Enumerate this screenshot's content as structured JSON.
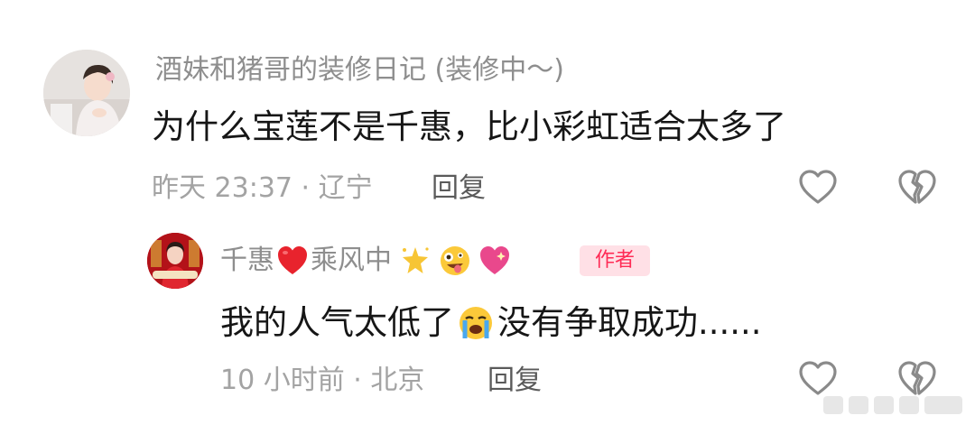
{
  "comment": {
    "username": "酒妹和猪哥的装修日记 (装修中～)",
    "text": "为什么宝莲不是千惠，比小彩虹适合太多了",
    "meta": "昨天 23:37 · 辽宁",
    "reply_label": "回复",
    "like_icon": "heart-outline-icon",
    "dislike_icon": "broken-heart-icon"
  },
  "reply": {
    "username_part1": "千惠",
    "username_part2": "乘风中",
    "badge": "作者",
    "text_part1": "我的人气太低了",
    "text_part2": "没有争取成功......",
    "meta": "10 小时前 · 北京",
    "reply_label": "回复",
    "like_icon": "heart-outline-icon",
    "dislike_icon": "broken-heart-icon",
    "username_emojis": [
      "red-heart-emoji",
      "sparkle-star-emoji",
      "zany-face-emoji",
      "sparkling-heart-emoji"
    ],
    "text_emoji": "loudly-crying-face-emoji"
  },
  "colors": {
    "username": "#8e8e8e",
    "text": "#161616",
    "meta": "#a3a3a3",
    "badge_bg": "#ffe0e6",
    "badge_text": "#ff2b55"
  }
}
